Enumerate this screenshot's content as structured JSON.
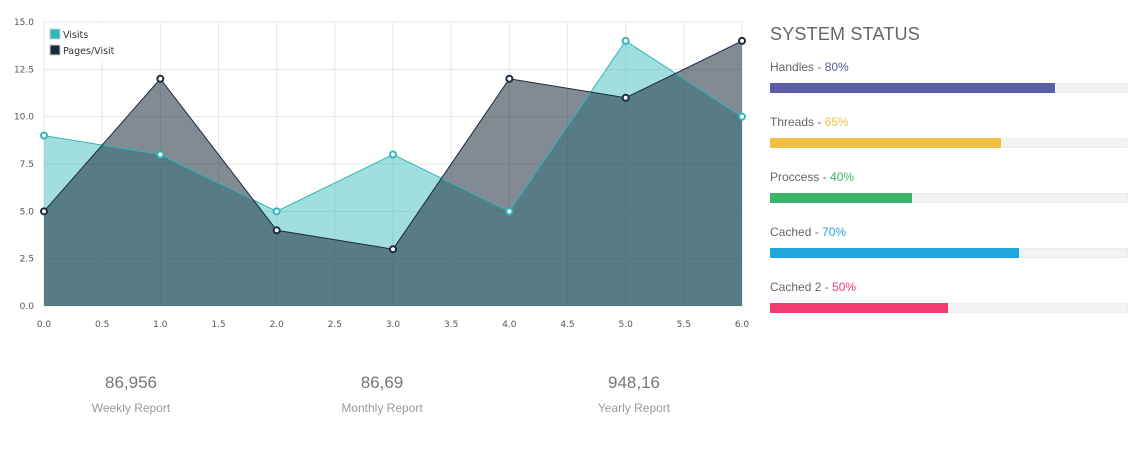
{
  "chart_data": {
    "type": "area",
    "xlim": [
      0,
      6
    ],
    "ylim": [
      0,
      15
    ],
    "x_ticks": [
      "0.0",
      "0.5",
      "1.0",
      "1.5",
      "2.0",
      "2.5",
      "3.0",
      "3.5",
      "4.0",
      "4.5",
      "5.0",
      "5.5",
      "6.0"
    ],
    "y_ticks": [
      "0.0",
      "2.5",
      "5.0",
      "7.5",
      "10.0",
      "12.5",
      "15.0"
    ],
    "grid": true,
    "legend_position": "top-left",
    "series": [
      {
        "name": "Visits",
        "color": "#2fb7b7",
        "x": [
          0,
          1,
          2,
          3,
          4,
          5,
          6
        ],
        "y": [
          9,
          8,
          5,
          8,
          5,
          14,
          10
        ]
      },
      {
        "name": "Pages/Visit",
        "color": "#1b2a3c",
        "x": [
          0,
          1,
          2,
          3,
          4,
          5,
          6
        ],
        "y": [
          5,
          12,
          4,
          3,
          12,
          11,
          14
        ]
      }
    ]
  },
  "stats": [
    {
      "value": "86,956",
      "label": "Weekly Report"
    },
    {
      "value": "86,69",
      "label": "Monthly Report"
    },
    {
      "value": "948,16",
      "label": "Yearly Report"
    }
  ],
  "status": {
    "title": "SYSTEM STATUS",
    "items": [
      {
        "name": "Handles",
        "percent": 80,
        "percent_text": "80%",
        "color": "#5b5ea6"
      },
      {
        "name": "Threads",
        "percent": 65,
        "percent_text": "65%",
        "color": "#f0c040"
      },
      {
        "name": "Proccess",
        "percent": 40,
        "percent_text": "40%",
        "color": "#3bb56a"
      },
      {
        "name": "Cached",
        "percent": 70,
        "percent_text": "70%",
        "color": "#1fa7db"
      },
      {
        "name": "Cached 2",
        "percent": 50,
        "percent_text": "50%",
        "color": "#f03c6e"
      }
    ]
  }
}
